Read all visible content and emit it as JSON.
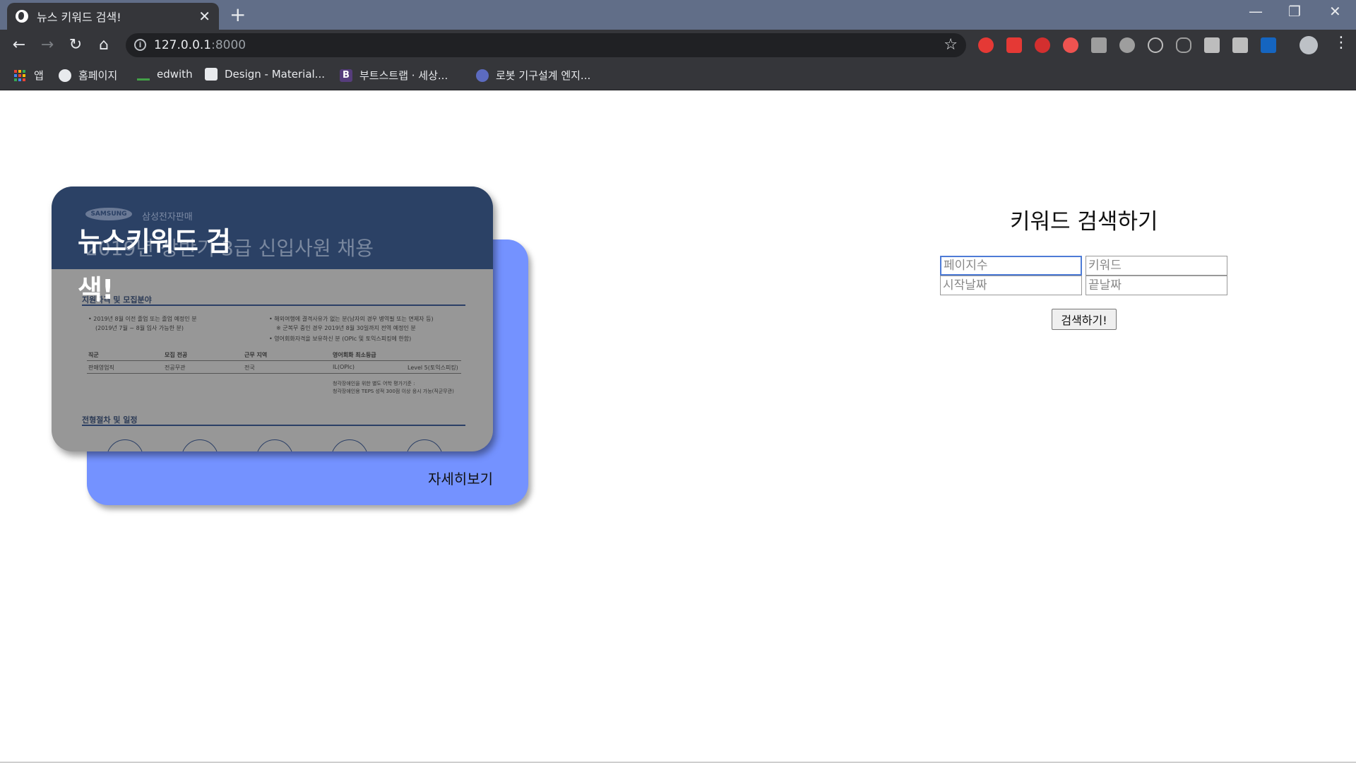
{
  "browser": {
    "tab_title": "뉴스 키워드 검색!",
    "url_host": "127.0.0.1",
    "url_port": ":8000",
    "bookmarks": [
      {
        "label": "앱",
        "icon": "apps-grid-icon"
      },
      {
        "label": "홈페이지",
        "icon": "globe-icon"
      },
      {
        "label": "edwith",
        "icon": "edwith-icon"
      },
      {
        "label": "Design - Material...",
        "icon": "material-icon"
      },
      {
        "label": "부트스트랩 · 세상...",
        "icon": "bootstrap-icon"
      },
      {
        "label": "로봇 기구설계 엔지...",
        "icon": "robot-icon"
      }
    ]
  },
  "card": {
    "heading": "뉴스키워드 검색!",
    "detail_link": "자세히보기",
    "poster": {
      "logo": "SAMSUNG",
      "company": "삼성전자판매",
      "title": "2019년 상반기 3급 신입사원 채용",
      "section1": "지원자격 및 모집분야",
      "section2": "전형절차 및 일정",
      "bullet1": "• 2019년 8월 이전 졸업 또는 졸업 예정인 분",
      "bullet1b": "(2019년 7월 ~ 8월 입사 가능한 분)",
      "bullet2": "• 해외여행에 결격사유가 없는 분(남자의 경우 병역필 또는 면제자 등)",
      "bullet2b": "※ 군복무 중인 경우 2019년 8월 30일까지 전역 예정인 분",
      "bullet3": "• 영어회화자격을 보유하신 분 (OPIc 및 토익스피킹에 한함)",
      "table_headers": [
        "직군",
        "모집 전공",
        "근무 지역",
        "영어회화 최소등급"
      ],
      "table_row": [
        "판매영업직",
        "전공무관",
        "전국",
        "IL(OPIc)",
        "Level 5(토익스피킹)"
      ],
      "note1": "청각장애인을 위한 별도 어학 평가기준 :",
      "note2": "청각장애인용 TEPS 성적 300점 이상 응시 가능(직군무관)"
    }
  },
  "search": {
    "title": "키워드 검색하기",
    "pages_placeholder": "페이지수",
    "keyword_placeholder": "키워드",
    "start_placeholder": "시작날짜",
    "end_placeholder": "끝날짜",
    "button": "검색하기!"
  }
}
